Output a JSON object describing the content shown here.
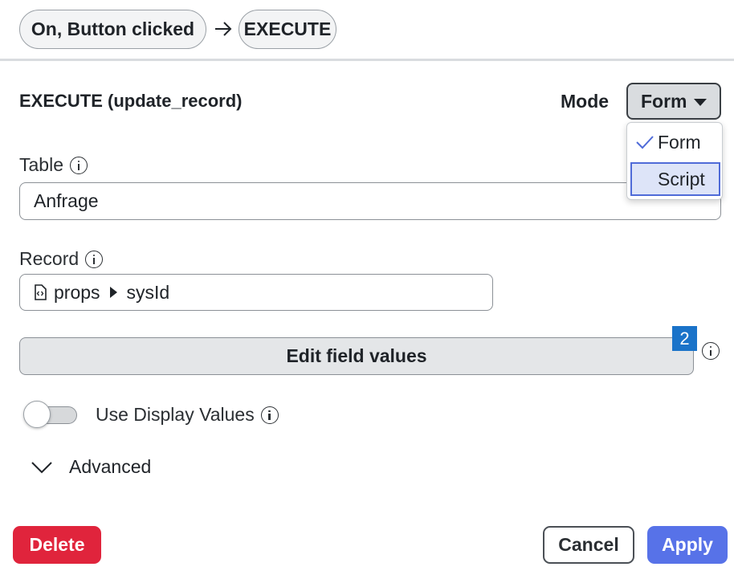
{
  "breadcrumb": {
    "trigger_label": "On, Button clicked",
    "action_label": "EXECUTE"
  },
  "panel": {
    "title": "EXECUTE (update_record)",
    "mode_label": "Mode",
    "mode_selected": "Form",
    "mode_options": [
      {
        "label": "Form",
        "checked": true
      },
      {
        "label": "Script",
        "highlighted": true
      }
    ]
  },
  "fields": {
    "table_label": "Table",
    "table_value": "Anfrage",
    "record_label": "Record",
    "record_path": [
      "props",
      "sysId"
    ]
  },
  "edit_field_values": {
    "label": "Edit field values",
    "badge_count": "2"
  },
  "display_values": {
    "label": "Use Display Values",
    "enabled": false
  },
  "advanced": {
    "label": "Advanced"
  },
  "footer": {
    "delete_label": "Delete",
    "cancel_label": "Cancel",
    "apply_label": "Apply"
  },
  "colors": {
    "delete": "#e0243c",
    "apply": "#5772e8",
    "badge": "#1a73c9",
    "highlight": "#dde4f8"
  }
}
